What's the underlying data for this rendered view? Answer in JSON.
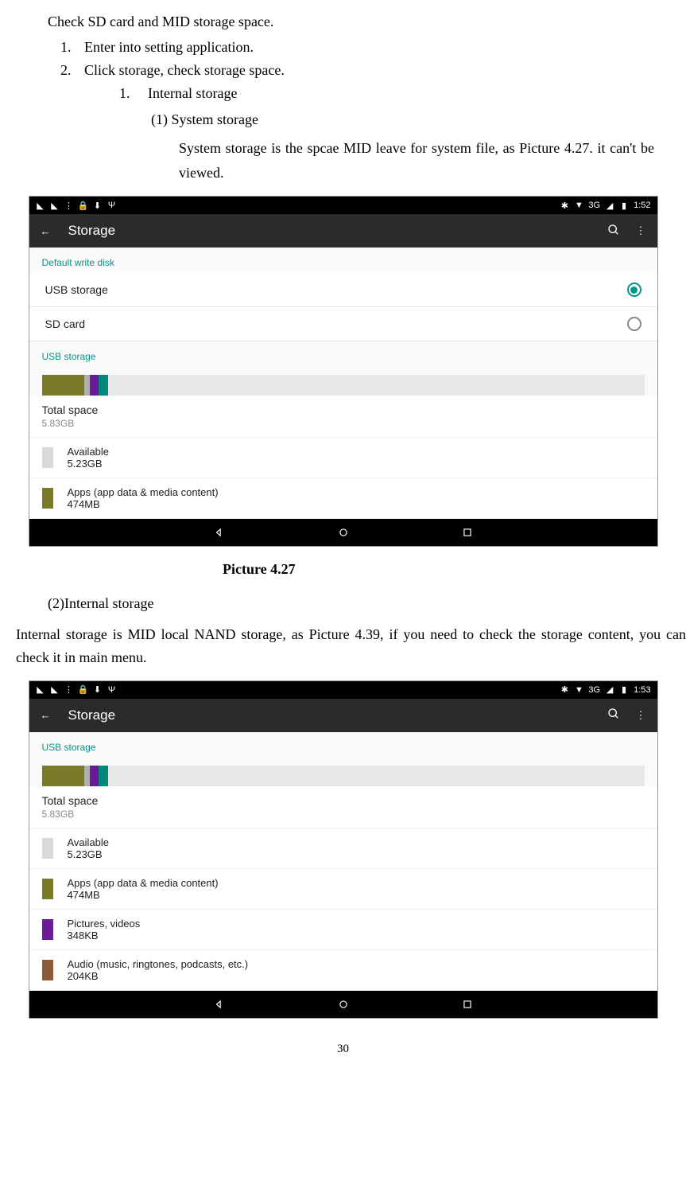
{
  "doc": {
    "intro": "Check SD card and MID storage space.",
    "step1_num": "1.",
    "step1": "Enter into setting application.",
    "step2_num": "2.",
    "step2": "Click storage, check storage space.",
    "sub1_num": "1.",
    "sub1": "Internal storage",
    "paren1": "(1) System storage",
    "paren1_body": "System storage is the spcae MID leave for system file, as Picture 4.27. it can't be viewed.",
    "caption1": "Picture 4.27",
    "paren2": "(2)Internal storage",
    "paren2_body": "Internal storage is MID local NAND storage, as Picture 4.39, if you need to check the storage content, you can check it in main menu.",
    "pagenum": "30"
  },
  "shot1": {
    "status_time": "1:52",
    "status_net": "3G",
    "appbar_title": "Storage",
    "section_default": "Default write disk",
    "opt_usb": "USB storage",
    "opt_sd": "SD card",
    "section_usb": "USB storage",
    "total_label": "Total space",
    "total_value": "5.83GB",
    "avail_label": "Available",
    "avail_value": "5.23GB",
    "apps_label": "Apps (app data & media content)",
    "apps_value": "474MB"
  },
  "shot2": {
    "status_time": "1:53",
    "status_net": "3G",
    "appbar_title": "Storage",
    "section_usb": "USB storage",
    "total_label": "Total space",
    "total_value": "5.83GB",
    "avail_label": "Available",
    "avail_value": "5.23GB",
    "apps_label": "Apps (app data & media content)",
    "apps_value": "474MB",
    "pics_label": "Pictures, videos",
    "pics_value": "348KB",
    "audio_label": "Audio (music, ringtones, podcasts, etc.)",
    "audio_value": "204KB"
  }
}
